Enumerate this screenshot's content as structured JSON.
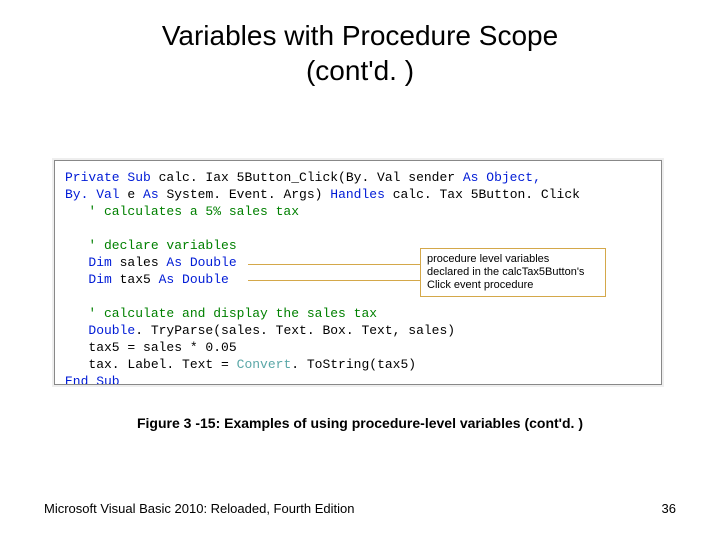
{
  "title_line1": "Variables with Procedure Scope",
  "title_line2": "(cont'd. )",
  "code": {
    "l1a": "Private Sub ",
    "l1b": "calc. Iax 5Button_Click(By. Val ",
    "l1c": "sender ",
    "l1d": "As Object,",
    "l2a": "By. Val ",
    "l2b": "e ",
    "l2c": "As ",
    "l2d": "System. Event. Args) ",
    "l2e": "Handles ",
    "l2f": "calc. Tax 5Button. Click",
    "l3": "   ' calculates a 5% sales tax",
    "l5": "   ' declare variables",
    "l6a": "   Dim ",
    "l6b": "sales ",
    "l6c": "As Double",
    "l7a": "   Dim ",
    "l7b": "tax5 ",
    "l7c": "As Double",
    "l9": "   ' calculate and display the sales tax",
    "l10a": "   Double",
    "l10b": ". TryParse(sales. Text. Box. Text, sales)",
    "l11": "   tax5 = sales * 0.05",
    "l12a": "   tax. Label. Text = ",
    "l12b": "Convert",
    "l12c": ". ToString(tax5)",
    "l13": "End Sub"
  },
  "callout": {
    "l1": "procedure level variables",
    "l2": "declared in the calcTax5Button's",
    "l3": "Click event procedure"
  },
  "caption": "Figure 3 -15: Examples of using procedure-level variables (cont'd. )",
  "footer_left": "Microsoft Visual Basic 2010: Reloaded, Fourth Edition",
  "page_number": "36"
}
